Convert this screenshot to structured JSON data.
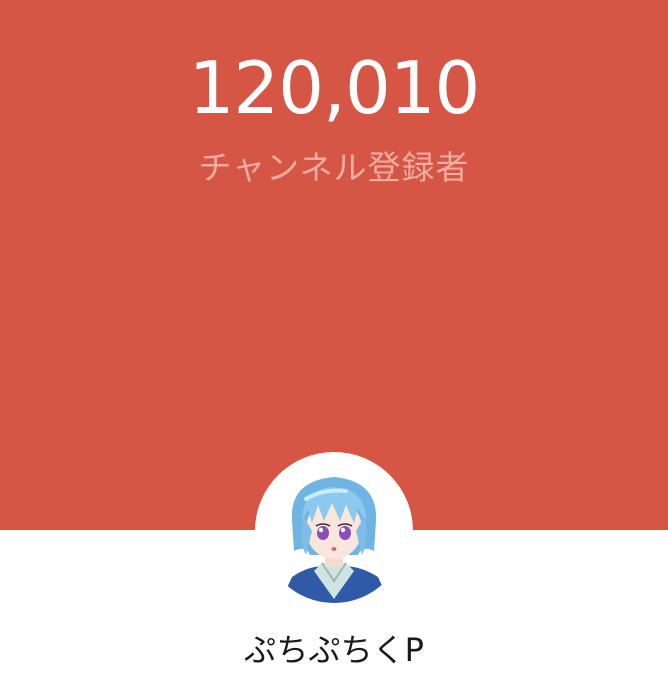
{
  "channel": {
    "subscriber_count": "120,010",
    "subscriber_label": "チャンネル登録者",
    "name": "ぷちぷちくP"
  },
  "colors": {
    "banner_background": "#d55644",
    "count_text": "#ffffff",
    "label_text": "#f0aba2",
    "page_background": "#ffffff",
    "name_text": "#1a1a1a"
  },
  "avatar": {
    "icon": "anime-character-avatar-icon"
  }
}
